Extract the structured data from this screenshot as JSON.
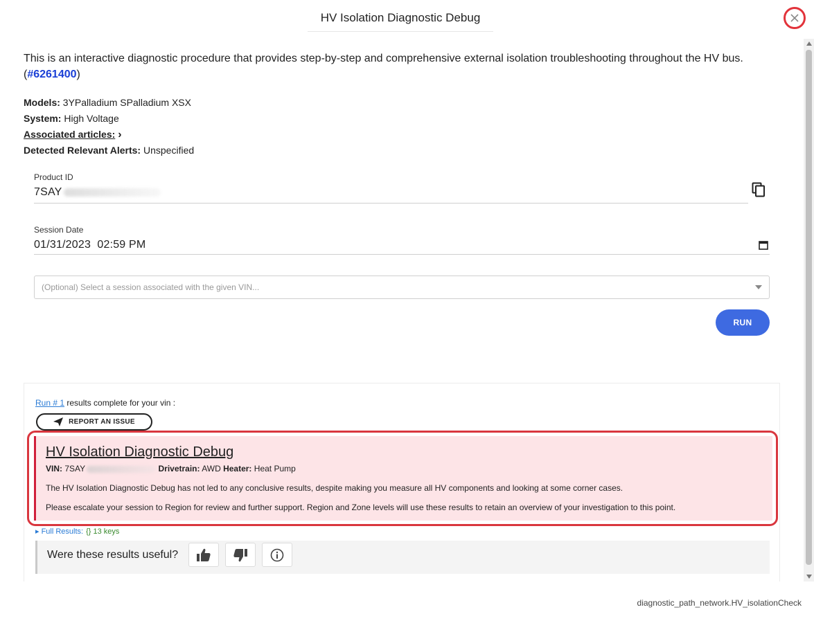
{
  "header": {
    "title": "HV Isolation Diagnostic Debug"
  },
  "intro": {
    "text": "This is an interactive diagnostic procedure that provides step-by-step and comprehensive external isolation troubleshooting throughout the HV bus. (",
    "link": "#6261400",
    "suffix": ")"
  },
  "meta": {
    "models_label": "Models:",
    "models_value": " 3YPalladium SPalladium XSX",
    "system_label": "System:",
    "system_value": " High Voltage",
    "articles_label": "Associated articles:",
    "articles_chevron": "›",
    "alerts_label": "Detected Relevant Alerts:",
    "alerts_value": " Unspecified"
  },
  "form": {
    "product_id_label": "Product ID",
    "product_id_value": "7SAY",
    "session_date_label": "Session Date",
    "session_date_value": "01/31/2023  02:59 PM",
    "session_select_placeholder": "(Optional) Select a session associated with the given VIN...",
    "run_label": "RUN"
  },
  "results": {
    "run_link": "Run # 1",
    "run_suffix": " results complete for your vin :",
    "report_label": "REPORT AN ISSUE",
    "alert": {
      "title": "HV Isolation Diagnostic Debug",
      "vin_label": "VIN:",
      "vin_value": " 7SAY",
      "drivetrain_label": "Drivetrain:",
      "drivetrain_value": " AWD ",
      "heater_label": "Heater:",
      "heater_value": " Heat Pump",
      "p1": "The HV Isolation Diagnostic Debug has not led to any conclusive results, despite making you measure all HV components and looking at some corner cases.",
      "p2": "Please escalate your session to Region for review and further support. Region and Zone levels will use these results to retain an overview of your investigation to this point."
    },
    "full_results_label": "▸ Full Results:",
    "full_results_keys": "{}  13 keys",
    "feedback_question": "Were these results useful?"
  },
  "footer": {
    "path": "diagnostic_path_network.HV_isolationCheck"
  },
  "colors": {
    "accent": "#3e6ae1",
    "alert_bg": "#fde4e7",
    "alert_border": "#d11f3b",
    "highlight": "#d9363e",
    "link": "#1a3fd6"
  }
}
